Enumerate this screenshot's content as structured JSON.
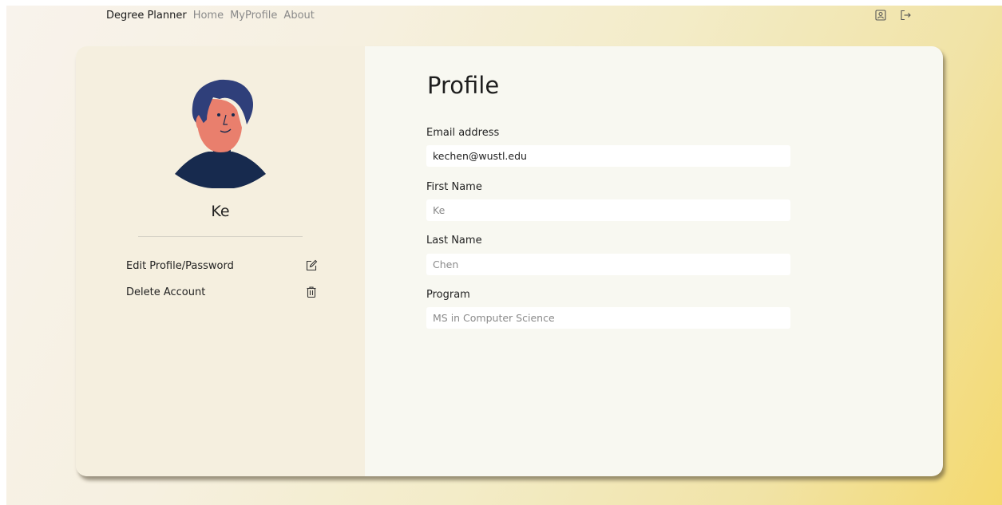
{
  "nav": {
    "brand": "Degree Planner",
    "links": [
      "Home",
      "MyProfile",
      "About"
    ],
    "icons": [
      "profile-icon",
      "logout-icon"
    ]
  },
  "sidebar": {
    "username": "Ke",
    "menu": [
      {
        "label": "Edit Profile/Password",
        "icon": "edit-icon"
      },
      {
        "label": "Delete Account",
        "icon": "trash-icon"
      }
    ]
  },
  "profile": {
    "title": "Profile",
    "fields": [
      {
        "label": "Email address",
        "value": "kechen@wustl.edu",
        "placeholder": ""
      },
      {
        "label": "First Name",
        "value": "",
        "placeholder": "Ke"
      },
      {
        "label": "Last Name",
        "value": "",
        "placeholder": "Chen"
      },
      {
        "label": "Program",
        "value": "",
        "placeholder": "MS in Computer Science"
      }
    ]
  },
  "colors": {
    "avatar_hair": "#2f3f7a",
    "avatar_skin": "#e97f6d",
    "avatar_shirt": "#172a4e"
  }
}
